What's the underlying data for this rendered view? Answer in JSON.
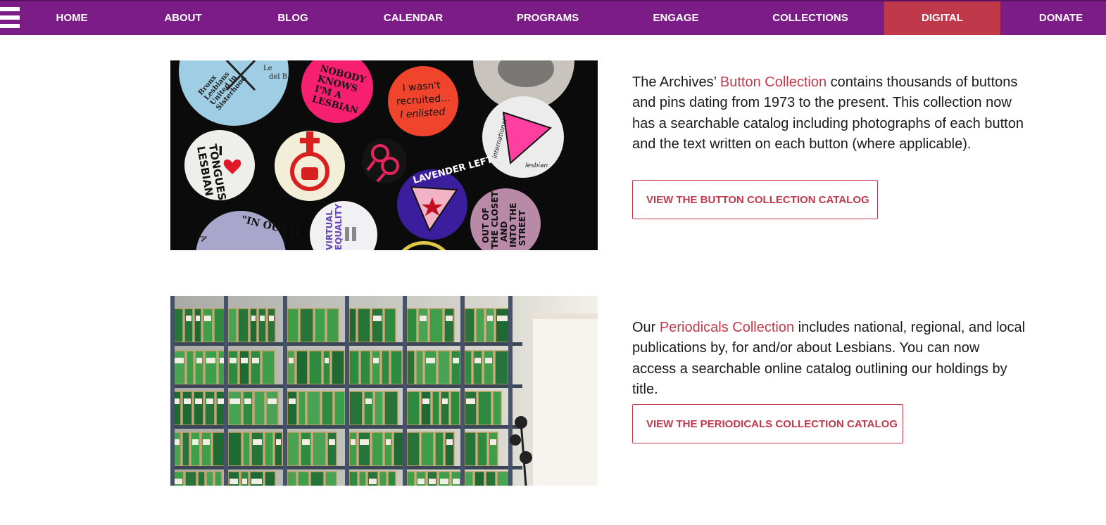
{
  "nav": {
    "items": [
      {
        "label": "HOME"
      },
      {
        "label": "ABOUT"
      },
      {
        "label": "BLOG"
      },
      {
        "label": "CALENDAR"
      },
      {
        "label": "PROGRAMS"
      },
      {
        "label": "ENGAGE"
      },
      {
        "label": "COLLECTIONS"
      },
      {
        "label": "DIGITAL",
        "active": true
      },
      {
        "label": "DONATE"
      }
    ],
    "menu_icon": "hamburger-menu-icon",
    "bg_color": "#7b1c87",
    "active_color": "#c0394b"
  },
  "buttons_section": {
    "image_buttons": [
      {
        "lines": [
          "Bronx",
          "Lesbians",
          "United in",
          "Sisterhood"
        ]
      },
      {
        "lines": [
          "NOBODY",
          "KNOWS",
          "I'M A",
          "LESBIAN"
        ]
      },
      {
        "lines": [
          "I wasn't",
          "recruited...",
          "I enlisted"
        ]
      },
      {
        "lines": [
          "international",
          "lesbian"
        ]
      },
      {
        "lines": [
          "I",
          "LESBIAN",
          "TONGUES"
        ]
      },
      {
        "lines": [
          "LAVENDER LEFT"
        ]
      },
      {
        "lines": [
          "OUT OF",
          "THE CLOSET",
          "AND",
          "INTO THE",
          "STREET"
        ]
      },
      {
        "lines": [
          "\"IN OUR O"
        ]
      },
      {
        "lines": [
          "VIRTUAL",
          "EQUALITY"
        ]
      }
    ],
    "text_before": "The Archives’ ",
    "link_text": "Button Collection",
    "text_after": " contains thousands of buttons and pins dating from 1973 to the present. This collection now has a searchable catalog including photographs of each button and the text written on each button (where applicable).",
    "cta_label": "VIEW THE BUTTON COLLECTION CATALOG"
  },
  "periodicals_section": {
    "text_before": "Our ",
    "link_text": "Periodicals Collection",
    "text_after": " includes national, regional, and local publications by, for and/or about Lesbians. You can now access a searchable online catalog outlining our holdings by title.",
    "cta_label": "VIEW THE PERIODICALS COLLECTION CATALOG"
  },
  "colors": {
    "link": "#c0394b",
    "text": "#1a1a1a",
    "nav": "#7b1c87"
  }
}
